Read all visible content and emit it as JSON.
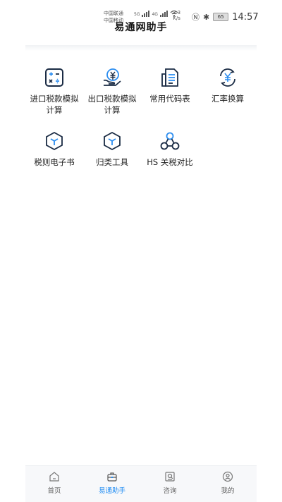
{
  "status_bar": {
    "carrier1": "中国联通",
    "carrier2": "中国移动",
    "net1": "5G",
    "net2": "4G",
    "speed_value": "3.3",
    "speed_unit": "K/s",
    "battery": "65",
    "time": "14:57"
  },
  "header": {
    "title": "易通网助手"
  },
  "tools": [
    {
      "label": "进口税款模拟计算",
      "icon": "calculator-icon"
    },
    {
      "label": "出口税款模拟计算",
      "icon": "yen-hand-icon"
    },
    {
      "label": "常用代码表",
      "icon": "document-list-icon"
    },
    {
      "label": "汇率换算",
      "icon": "currency-exchange-icon"
    },
    {
      "label": "税则电子书",
      "icon": "cube-icon"
    },
    {
      "label": "归类工具",
      "icon": "cube-icon"
    },
    {
      "label": "HS 关税对比",
      "icon": "network-icon"
    }
  ],
  "bottom_nav": [
    {
      "label": "首页",
      "icon": "home-icon",
      "active": false
    },
    {
      "label": "易通助手",
      "icon": "briefcase-icon",
      "active": true
    },
    {
      "label": "咨询",
      "icon": "consult-icon",
      "active": false
    },
    {
      "label": "我的",
      "icon": "profile-icon",
      "active": false
    }
  ],
  "colors": {
    "accent": "#1f8cf3",
    "icon_dark": "#1a2b44",
    "icon_blue": "#2b8df0"
  }
}
